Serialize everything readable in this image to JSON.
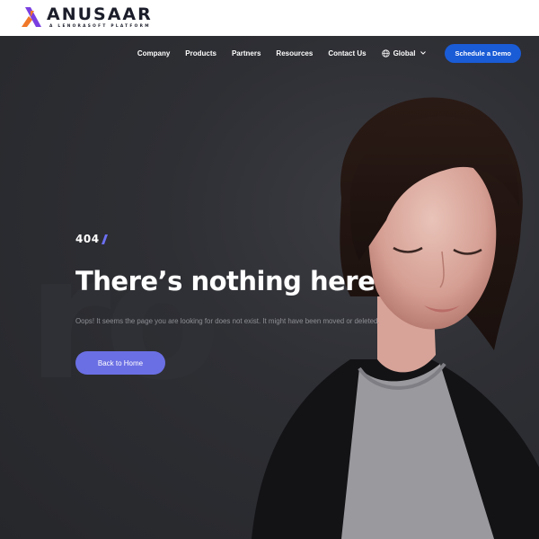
{
  "brand": {
    "name": "ANUSAAR",
    "tagline": "A LENORASOFT PLATFORM",
    "colors": {
      "primary": "#1a5bd6",
      "accent": "#6b6fe4",
      "logo_orange": "#f0782a",
      "logo_purple": "#7a3fe0"
    }
  },
  "nav": {
    "items": [
      "Company",
      "Products",
      "Partners",
      "Resources",
      "Contact Us"
    ],
    "region_label": "Global",
    "cta_label": "Schedule a Demo",
    "icons": {
      "region": "globe-icon",
      "region_toggle": "chevron-down-icon"
    }
  },
  "error": {
    "code": "404",
    "background_text": "ro",
    "title": "There’s nothing here",
    "message": "Oops! It seems the page you are looking for does not exist. It might have been moved or deleted.",
    "button_label": "Back to Home"
  }
}
